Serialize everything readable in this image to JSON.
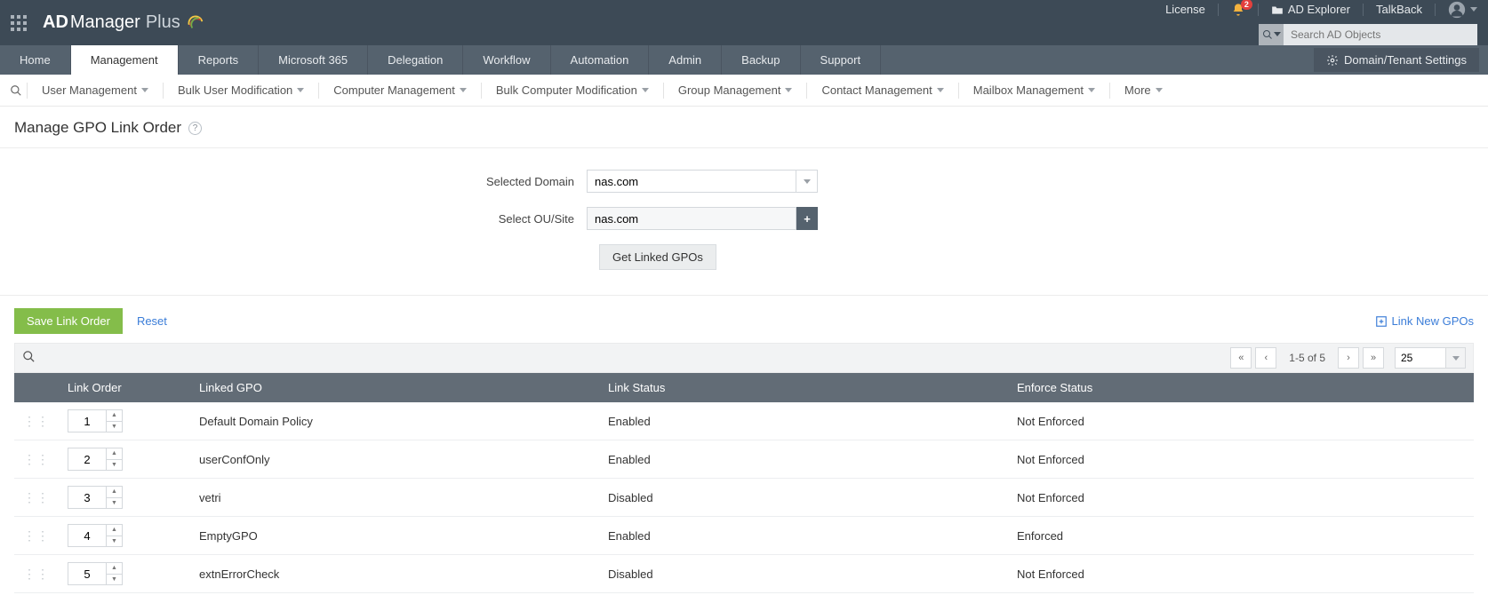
{
  "top": {
    "license": "License",
    "notif_count": "2",
    "explorer": "AD Explorer",
    "talkback": "TalkBack",
    "search_placeholder": "Search AD Objects"
  },
  "logo": {
    "ad": "AD",
    "manager": "Manager",
    "plus": "Plus"
  },
  "nav": {
    "home": "Home",
    "management": "Management",
    "reports": "Reports",
    "m365": "Microsoft 365",
    "delegation": "Delegation",
    "workflow": "Workflow",
    "automation": "Automation",
    "admin": "Admin",
    "backup": "Backup",
    "support": "Support",
    "settings": "Domain/Tenant Settings"
  },
  "subnav": {
    "user": "User Management",
    "bulkuser": "Bulk User Modification",
    "computer": "Computer Management",
    "bulkcomp": "Bulk Computer Modification",
    "group": "Group Management",
    "contact": "Contact Management",
    "mailbox": "Mailbox Management",
    "more": "More"
  },
  "page": {
    "title": "Manage GPO Link Order"
  },
  "form": {
    "domain_label": "Selected Domain",
    "domain_value": "nas.com",
    "ou_label": "Select OU/Site",
    "ou_value": "nas.com",
    "get_btn": "Get Linked GPOs"
  },
  "actions": {
    "save": "Save Link Order",
    "reset": "Reset",
    "link_new": "Link New GPOs"
  },
  "pager": {
    "text": "1-5 of 5",
    "size": "25"
  },
  "table": {
    "headers": {
      "order": "Link Order",
      "gpo": "Linked GPO",
      "link": "Link Status",
      "enforce": "Enforce Status"
    },
    "rows": [
      {
        "order": "1",
        "gpo": "Default Domain Policy",
        "link": "Enabled",
        "enforce": "Not Enforced"
      },
      {
        "order": "2",
        "gpo": "userConfOnly",
        "link": "Enabled",
        "enforce": "Not Enforced"
      },
      {
        "order": "3",
        "gpo": "vetri",
        "link": "Disabled",
        "enforce": "Not Enforced"
      },
      {
        "order": "4",
        "gpo": "EmptyGPO",
        "link": "Enabled",
        "enforce": "Enforced"
      },
      {
        "order": "5",
        "gpo": "extnErrorCheck",
        "link": "Disabled",
        "enforce": "Not Enforced"
      }
    ]
  }
}
